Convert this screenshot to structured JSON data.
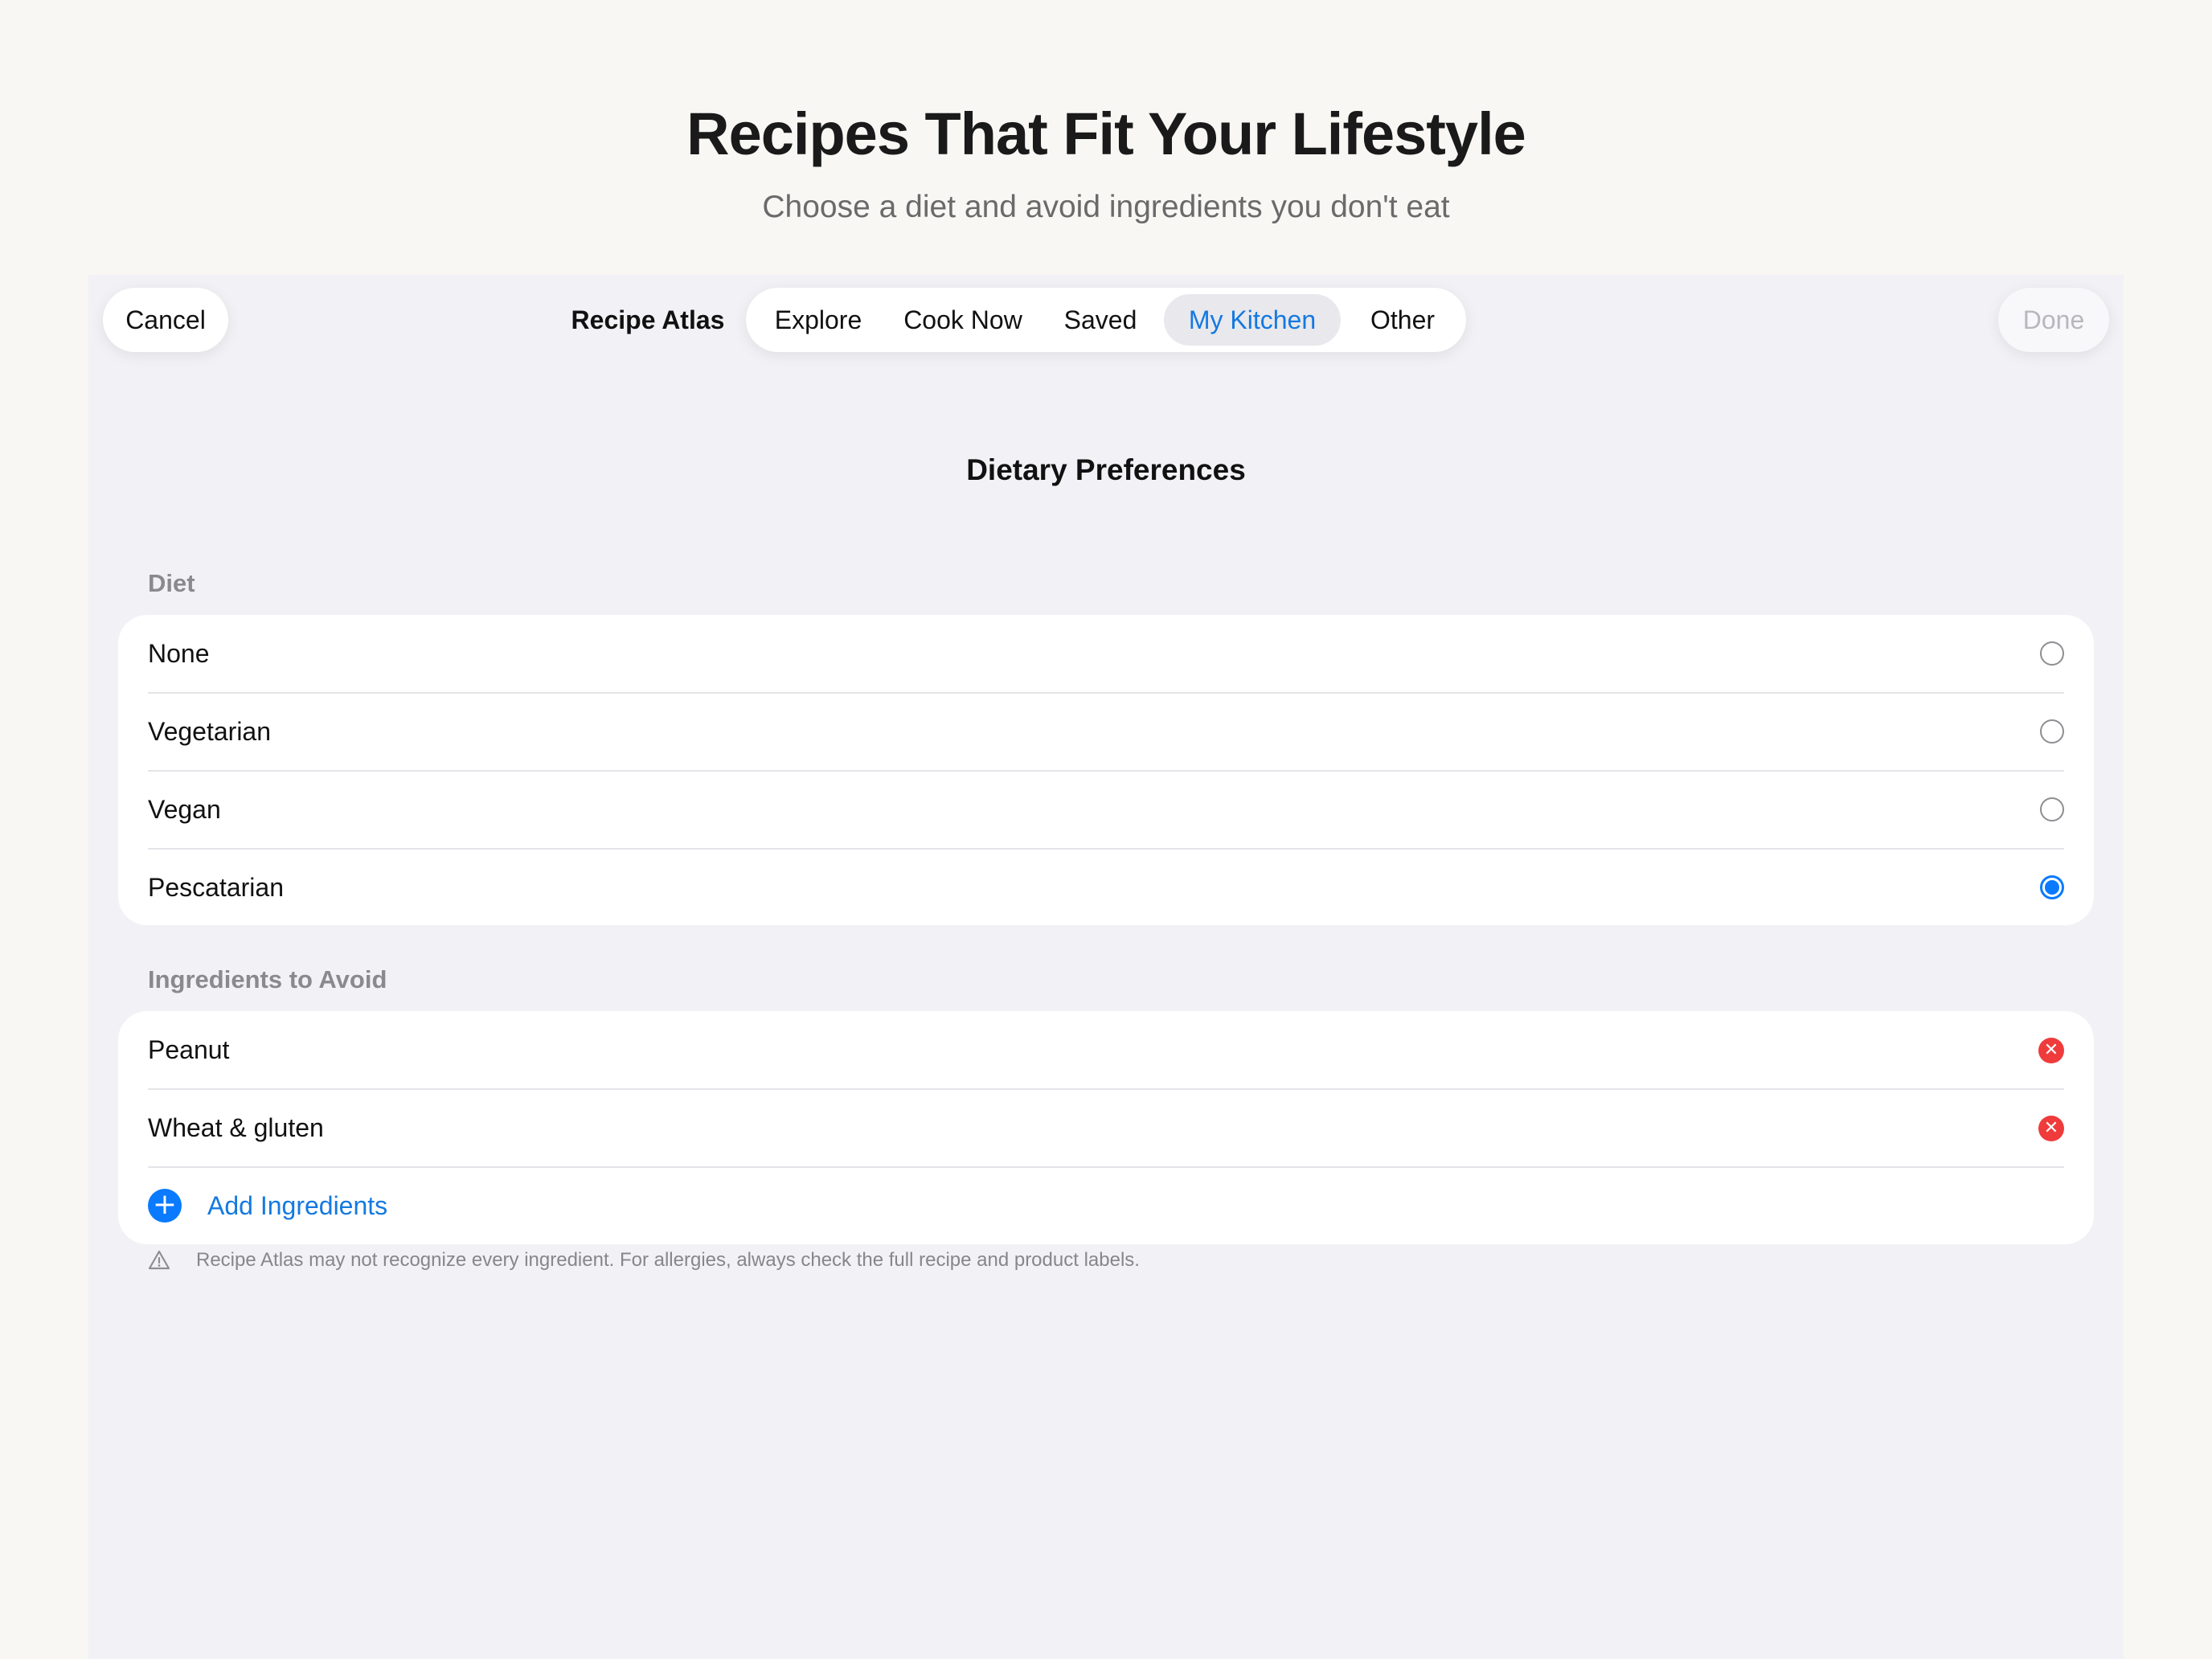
{
  "hero": {
    "title": "Recipes That Fit Your Lifestyle",
    "subtitle": "Choose a diet and avoid ingredients you don't eat"
  },
  "toolbar": {
    "cancel_label": "Cancel",
    "done_label": "Done",
    "app_name": "Recipe Atlas",
    "tabs": [
      {
        "label": "Explore",
        "active": false
      },
      {
        "label": "Cook Now",
        "active": false
      },
      {
        "label": "Saved",
        "active": false
      },
      {
        "label": "My Kitchen",
        "active": true
      },
      {
        "label": "Other",
        "active": false
      }
    ]
  },
  "page": {
    "heading": "Dietary Preferences",
    "diet": {
      "label": "Diet",
      "options": [
        {
          "label": "None",
          "selected": false
        },
        {
          "label": "Vegetarian",
          "selected": false
        },
        {
          "label": "Vegan",
          "selected": false
        },
        {
          "label": "Pescatarian",
          "selected": true
        }
      ]
    },
    "avoid": {
      "label": "Ingredients to Avoid",
      "items": [
        {
          "label": "Peanut"
        },
        {
          "label": "Wheat & gluten"
        }
      ],
      "add_label": "Add Ingredients"
    },
    "notice": "Recipe Atlas may not recognize every ingredient. For allergies, always check the full recipe and product labels."
  },
  "colors": {
    "accent": "#0a7aff",
    "link": "#1479e0",
    "remove": "#ef3b3b",
    "panel_bg": "#f2f2f6",
    "page_bg": "#f8f7f4"
  },
  "icons": {
    "radio": "radio-button-icon",
    "remove": "remove-circle-icon",
    "add": "plus-circle-icon",
    "warning": "warning-triangle-icon"
  }
}
